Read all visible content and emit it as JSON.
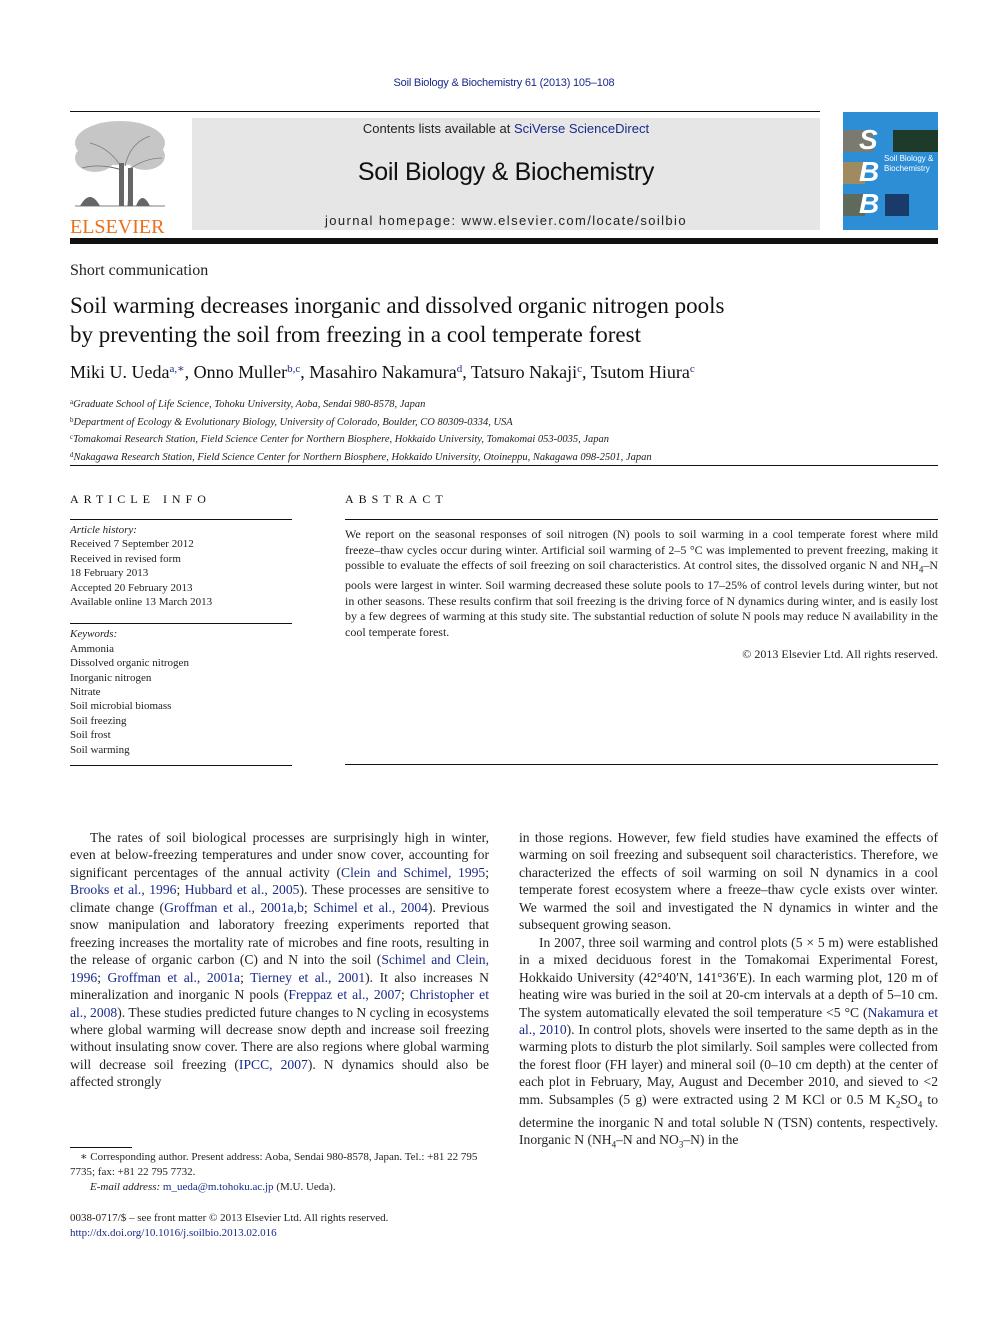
{
  "header": {
    "running_head": "Soil Biology & Biochemistry 61 (2013) 105–108",
    "publisher_logo_text": "ELSEVIER",
    "contents_prefix": "Contents lists available at ",
    "contents_link": "SciVerse ScienceDirect",
    "journal_title": "Soil Biology & Biochemistry",
    "homepage_prefix": "journal homepage: ",
    "homepage_url": "www.elsevier.com/locate/soilbio",
    "cover": {
      "initials": [
        "S",
        "B",
        "B"
      ],
      "title_line1": "Soil Biology &",
      "title_line2": "Biochemistry"
    },
    "colors": {
      "elsevier_orange": "#e9711c",
      "link_blue": "#1a2a8a",
      "cover_blue": "#2d8ed6",
      "masthead_gray": "#e6e6e6"
    }
  },
  "article": {
    "type": "Short communication",
    "title_line1": "Soil warming decreases inorganic and dissolved organic nitrogen pools",
    "title_line2": "by preventing the soil from freezing in a cool temperate forest",
    "authors": [
      {
        "name": "Miki U. Ueda",
        "sup": "a,∗",
        "sep": ", "
      },
      {
        "name": "Onno Muller",
        "sup": "b,c",
        "sep": ", "
      },
      {
        "name": "Masahiro Nakamura",
        "sup": "d",
        "sep": ", "
      },
      {
        "name": "Tatsuro Nakaji",
        "sup": "c",
        "sep": ", "
      },
      {
        "name": "Tsutom Hiura",
        "sup": "c",
        "sep": ""
      }
    ],
    "affiliations": [
      {
        "key": "a",
        "text": "Graduate School of Life Science, Tohoku University, Aoba, Sendai 980-8578, Japan"
      },
      {
        "key": "b",
        "text": "Department of Ecology & Evolutionary Biology, University of Colorado, Boulder, CO 80309-0334, USA"
      },
      {
        "key": "c",
        "text": "Tomakomai Research Station, Field Science Center for Northern Biosphere, Hokkaido University, Tomakomai 053-0035, Japan"
      },
      {
        "key": "d",
        "text": "Nakagawa Research Station, Field Science Center for Northern Biosphere, Hokkaido University, Otoineppu, Nakagawa 098-2501, Japan"
      }
    ]
  },
  "article_info": {
    "heading": "ARTICLE INFO",
    "history_label": "Article history:",
    "history": [
      "Received 7 September 2012",
      "Received in revised form",
      "18 February 2013",
      "Accepted 20 February 2013",
      "Available online 13 March 2013"
    ],
    "keywords_label": "Keywords:",
    "keywords": [
      "Ammonia",
      "Dissolved organic nitrogen",
      "Inorganic nitrogen",
      "Nitrate",
      "Soil microbial biomass",
      "Soil freezing",
      "Soil frost",
      "Soil warming"
    ]
  },
  "abstract": {
    "heading": "ABSTRACT",
    "p1": "We report on the seasonal responses of soil nitrogen (N) pools to soil warming in a cool temperate forest where mild freeze–thaw cycles occur during winter. Artificial soil warming of 2–5 °C was implemented to prevent freezing, making it possible to evaluate the effects of soil freezing on soil characteristics. At control sites, the dissolved organic N and NH",
    "p1_sub": "4",
    "p2": "–N pools were largest in winter. Soil warming decreased these solute pools to 17–25% of control levels during winter, but not in other seasons. These results confirm that soil freezing is the driving force of N dynamics during winter, and is easily lost by a few degrees of warming at this study site. The substantial reduction of solute N pools may reduce N availability in the cool temperate forest.",
    "copyright": "© 2013 Elsevier Ltd. All rights reserved."
  },
  "body": {
    "left": [
      {
        "t": "The rates of soil biological processes are surprisingly high in winter, even at below-freezing temperatures and under snow cover, accounting for significant percentages of the annual activity ("
      },
      {
        "link": "Clein and Schimel, 1995"
      },
      {
        "t": "; "
      },
      {
        "link": "Brooks et al., 1996"
      },
      {
        "t": "; "
      },
      {
        "link": "Hubbard et al., 2005"
      },
      {
        "t": "). These processes are sensitive to climate change ("
      },
      {
        "link": "Groffman et al., 2001a,b"
      },
      {
        "t": "; "
      },
      {
        "link": "Schimel et al., 2004"
      },
      {
        "t": "). Previous snow manipulation and laboratory freezing experiments reported that freezing increases the mortality rate of microbes and fine roots, resulting in the release of organic carbon (C) and N into the soil ("
      },
      {
        "link": "Schimel and Clein, 1996"
      },
      {
        "t": "; "
      },
      {
        "link": "Groffman et al., 2001a"
      },
      {
        "t": "; "
      },
      {
        "link": "Tierney et al., 2001"
      },
      {
        "t": "). It also increases N mineralization and inorganic N pools ("
      },
      {
        "link": "Freppaz et al., 2007"
      },
      {
        "t": "; "
      },
      {
        "link": "Christopher et al., 2008"
      },
      {
        "t": "). These studies predicted future changes to N cycling in ecosystems where global warming will decrease snow depth and increase soil freezing without insulating snow cover. There are also regions where global warming will decrease soil freezing ("
      },
      {
        "link": "IPCC, 2007"
      },
      {
        "t": "). N dynamics should also be affected strongly"
      }
    ],
    "right_p1": "in those regions. However, few field studies have examined the effects of warming on soil freezing and subsequent soil characteristics. Therefore, we characterized the effects of soil warming on soil N dynamics in a cool temperate forest ecosystem where a freeze–thaw cycle exists over winter. We warmed the soil and investigated the N dynamics in winter and the subsequent growing season.",
    "right_p2a": "In 2007, three soil warming and control plots (5 × 5 m) were established in a mixed deciduous forest in the Tomakomai Experimental Forest, Hokkaido University (42°40′N, 141°36′E). In each warming plot, 120 m of heating wire was buried in the soil at 20-cm intervals at a depth of 5–10 cm. The system automatically elevated the soil temperature <5 °C (",
    "right_p2_link": "Nakamura et al., 2010",
    "right_p2b": "). In control plots, shovels were inserted to the same depth as in the warming plots to disturb the plot similarly. Soil samples were collected from the forest floor (FH layer) and mineral soil (0–10 cm depth) at the center of each plot in February, May, August and December 2010, and sieved to <2 mm. Subsamples (5 g) were extracted using 2 M KCl or 0.5 M K",
    "right_p2_sub1": "2",
    "right_p2c": "SO",
    "right_p2_sub2": "4",
    "right_p2d": " to determine the inorganic N and total soluble N (TSN) contents, respectively. Inorganic N (NH",
    "right_p2_sub3": "4",
    "right_p2e": "–N and NO",
    "right_p2_sub4": "3",
    "right_p2f": "–N) in the"
  },
  "footnotes": {
    "corresponding": "∗ Corresponding author. Present address: Aoba, Sendai 980-8578, Japan. Tel.: +81 22 795 7735; fax: +81 22 795 7732.",
    "email_label": "E-mail address: ",
    "email": "m_ueda@m.tohoku.ac.jp",
    "email_suffix": " (M.U. Ueda).",
    "front_matter": "0038-0717/$ – see front matter © 2013 Elsevier Ltd. All rights reserved.",
    "doi": "http://dx.doi.org/10.1016/j.soilbio.2013.02.016"
  }
}
